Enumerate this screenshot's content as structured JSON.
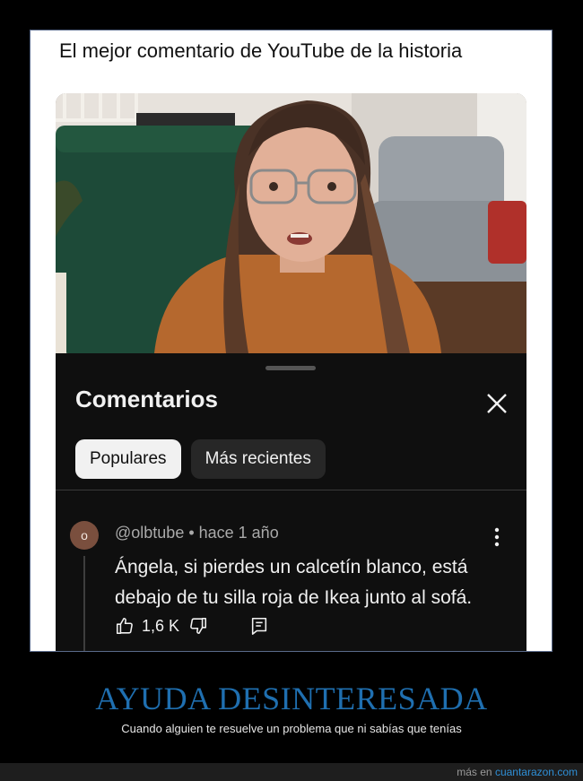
{
  "post": {
    "title": "El mejor comentario de YouTube de la historia"
  },
  "video": {
    "description_icon": "video-frame"
  },
  "comments_panel": {
    "title": "Comentarios",
    "close_icon": "close-icon",
    "tabs": [
      {
        "label": "Populares",
        "selected": true
      },
      {
        "label": "Más recientes",
        "selected": false
      }
    ]
  },
  "comment": {
    "avatar_letter": "o",
    "meta": "@olbtube • hace 1 año",
    "text": "Ángela, si pierdes un calcetín blanco, está debajo de tu silla roja de Ikea junto al sofá.",
    "likes": "1,6 K",
    "icons": [
      "thumb-up-icon",
      "thumb-down-icon",
      "reply-icon",
      "more-vert-icon"
    ]
  },
  "caption": {
    "headline": "AYUDA DESINTERESADA",
    "subline": "Cuando alguien te resuelve un problema que ni sabías que tenías"
  },
  "footer": {
    "prefix": "más en",
    "site": "cuantarazon.com"
  },
  "colors": {
    "headline": "#1f6fb0",
    "panel_bg": "#0f0f0f",
    "link": "#2f8fd6"
  }
}
